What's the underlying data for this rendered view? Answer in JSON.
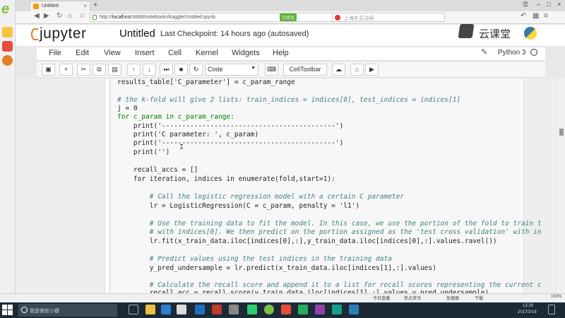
{
  "browser": {
    "tab_title": "Untitled",
    "url_host": "localhost",
    "url_rest": ":8888/notebooks/kaggle/",
    "url_tail": "Untitled.ipynb",
    "url_scheme": "http://",
    "badge": "已优化",
    "search_placeholder": "上海东亚法网"
  },
  "jupyter": {
    "logo_text": "jupyter",
    "title": "Untitled",
    "checkpoint": "Last Checkpoint: 14 hours ago (autosaved)",
    "kernel": "Python 3",
    "menu": [
      "File",
      "Edit",
      "View",
      "Insert",
      "Cell",
      "Kernel",
      "Widgets",
      "Help"
    ],
    "cell_type": "Code",
    "celltoolbar_label": "CellToolbar"
  },
  "brand": {
    "text": "云课堂"
  },
  "code_lines": [
    "results_table['C_parameter'] = c_param_range",
    "",
    "# the k-fold will give 2 lists: train_indices = indices[0], test_indices = indices[1]",
    "j = 0",
    "for c_param in c_param_range:",
    "    print('-------------------------------------------')",
    "    print('C parameter: ', c_param)",
    "    print('-------------------------------------------')",
    "    print('')",
    "",
    "    recall_accs = []",
    "    for iteration, indices in enumerate(fold,start=1):",
    "",
    "        # Call the logistic regression model with a certain C parameter",
    "        lr = LogisticRegression(C = c_param, penalty = 'l1')",
    "",
    "        # Use the training data to fit the model. In this case, we use the portion of the fold to train t",
    "        # with indices[0]. We then predict on the portion assigned as the 'test cross validation' with in",
    "        lr.fit(x_train_data.iloc[indices[0],:],y_train_data.iloc[indices[0],:].values.ravel())",
    "",
    "        # Predict values using the test indices in the training data",
    "        y_pred_undersample = lr.predict(x_train_data.iloc[indices[1],:].values)",
    "",
    "        # Calculate the recall score and append it to a list for recall scores representing the current c",
    "        recall_acc = recall_score(y_train_data.iloc[indices[1],:].values,y_pred_undersample)"
  ],
  "statusbar": {
    "today": "今日直播",
    "hot": "热点资讯",
    "speed": "加速器",
    "download": "下载",
    "zoom": "150%"
  },
  "taskbar": {
    "search_placeholder": "我是微软小娜",
    "time": "13:29",
    "date": "2017/2/18"
  }
}
